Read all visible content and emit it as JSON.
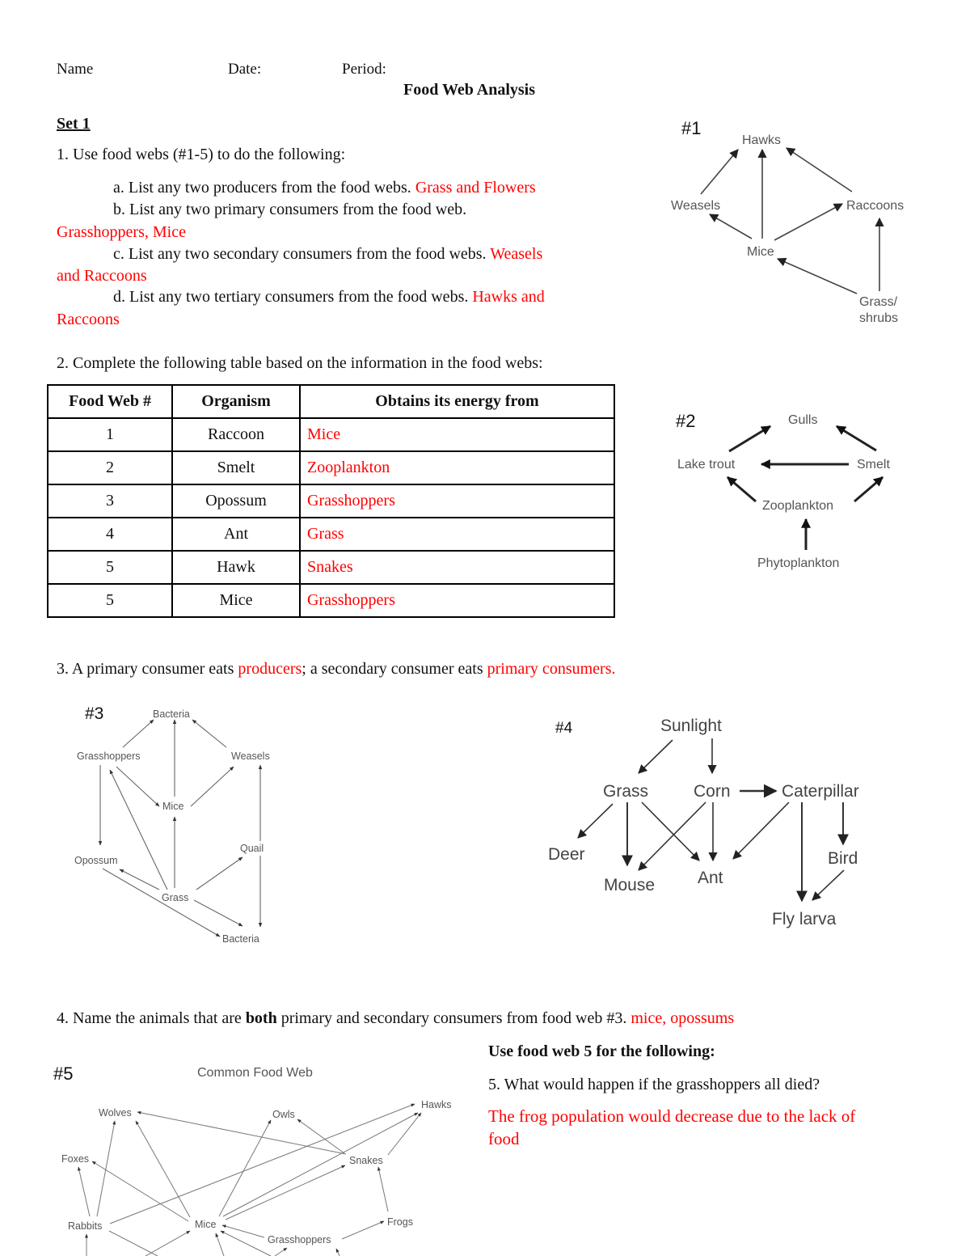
{
  "header": {
    "name_label": "Name",
    "date_label": "Date:",
    "period_label": "Period:",
    "title": "Food Web Analysis"
  },
  "set_title": "Set 1",
  "q1": {
    "prompt": "1. Use food webs (#1-5) to do the following:",
    "a": {
      "question": "a. List any two producers from the food webs.",
      "answer": "Grass and Flowers"
    },
    "b": {
      "question": "b. List any two primary consumers from the food web.",
      "answer": "Grasshoppers, Mice"
    },
    "c": {
      "question": "c. List any two secondary consumers from the food webs.",
      "answer_line1": "Weasels",
      "answer_line2": "and Raccoons"
    },
    "d": {
      "question": "d. List any two tertiary consumers from the food webs.",
      "answer_line1": "Hawks and",
      "answer_line2": "Raccoons"
    }
  },
  "q2": {
    "prompt": "2. Complete the following table based on the information in the food webs:",
    "columns": [
      "Food Web #",
      "Organism",
      "Obtains its energy from"
    ],
    "rows": [
      {
        "web": "1",
        "organism": "Raccoon",
        "energy": "Mice"
      },
      {
        "web": "2",
        "organism": "Smelt",
        "energy": "Zooplankton"
      },
      {
        "web": "3",
        "organism": "Opossum",
        "energy": "Grasshoppers"
      },
      {
        "web": "4",
        "organism": "Ant",
        "energy": "Grass"
      },
      {
        "web": "5",
        "organism": "Hawk",
        "energy": "Snakes"
      },
      {
        "web": "5",
        "organism": "Mice",
        "energy": "Grasshoppers"
      }
    ]
  },
  "q3": {
    "part1": "3. A primary consumer eats",
    "answer1": "producers",
    "part2": "; a secondary consumer eats",
    "answer2": "primary consumers."
  },
  "q4": {
    "part1": "4. Name the animals that are",
    "bold": "both",
    "part2": "primary and secondary consumers from food web #3.",
    "answer": "mice, opossums"
  },
  "q5": {
    "intro": "Use food web 5 for the following:",
    "question": "5. What would happen if the grasshoppers all died?",
    "answer_line1": "The frog population would decrease due to the lack of",
    "answer_line2": "food"
  },
  "webs": {
    "web1": {
      "label": "#1",
      "nodes": {
        "hawks": "Hawks",
        "weasels": "Weasels",
        "raccoons": "Raccoons",
        "mice": "Mice",
        "grass1": "Grass/",
        "grass2": "shrubs"
      }
    },
    "web2": {
      "label": "#2",
      "nodes": {
        "gulls": "Gulls",
        "trout": "Lake trout",
        "smelt": "Smelt",
        "zoo": "Zooplankton",
        "phyto": "Phytoplankton"
      }
    },
    "web3": {
      "label": "#3",
      "nodes": {
        "bact_top": "Bacteria",
        "grasshoppers": "Grasshoppers",
        "weasels": "Weasels",
        "mice": "Mice",
        "opossum": "Opossum",
        "quail": "Quail",
        "grass": "Grass",
        "bact_bottom": "Bacteria"
      }
    },
    "web4": {
      "label": "#4",
      "nodes": {
        "sunlight": "Sunlight",
        "grass": "Grass",
        "corn": "Corn",
        "caterpillar": "Caterpillar",
        "deer": "Deer",
        "mouse": "Mouse",
        "ant": "Ant",
        "bird": "Bird",
        "fly": "Fly larva"
      }
    },
    "web5": {
      "label": "#5",
      "title": "Common Food Web",
      "nodes": {
        "wolves": "Wolves",
        "owls": "Owls",
        "hawks": "Hawks",
        "foxes": "Foxes",
        "snakes": "Snakes",
        "rabbits": "Rabbits",
        "mice": "Mice",
        "frogs": "Frogs",
        "grasshoppers": "Grasshoppers"
      }
    }
  },
  "colors": {
    "answer": "#ff0000",
    "text": "#111111",
    "diagram_text": "#555555"
  }
}
